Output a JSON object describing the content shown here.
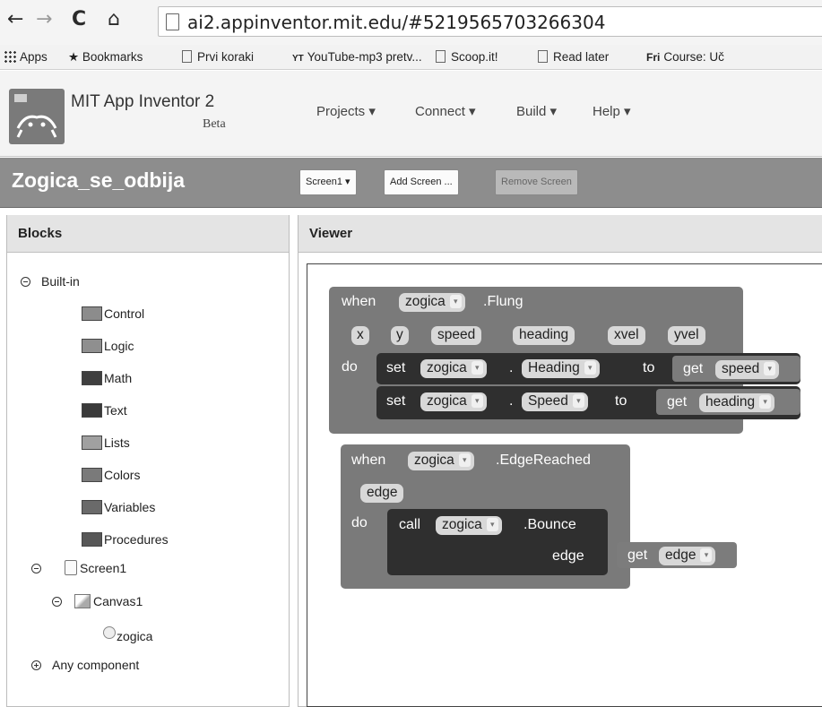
{
  "browser": {
    "url": "ai2.appinventor.mit.edu/#5219565703266304",
    "bookmarks": [
      "Apps",
      "Bookmarks",
      "Prvi koraki",
      "YouTube-mp3 pretv...",
      "Scoop.it!",
      "Read later",
      "Course: Uč"
    ],
    "bookmark_icons": [
      "apps-grid-icon",
      "star-icon",
      "page-icon",
      "youtube-mp3-icon",
      "page-icon",
      "page-icon",
      "fri-icon"
    ],
    "icons": [
      "back-arrow-icon",
      "forward-arrow-icon",
      "reload-icon",
      "home-icon",
      "page-icon"
    ]
  },
  "app": {
    "title": "MIT App Inventor 2",
    "subtitle": "Beta",
    "menu": [
      "Projects ▾",
      "Connect ▾",
      "Build ▾",
      "Help ▾"
    ]
  },
  "project": {
    "name": "Zogica_se_odbija",
    "screen_dropdown": "Screen1 ▾",
    "add_screen": "Add Screen ...",
    "remove_screen": "Remove Screen"
  },
  "blocks_panel": {
    "title": "Blocks",
    "builtin_label": "Built-in",
    "builtin": [
      "Control",
      "Logic",
      "Math",
      "Text",
      "Lists",
      "Colors",
      "Variables",
      "Procedures"
    ],
    "builtin_colors": [
      "#8c8c8c",
      "#8f8f8f",
      "#3f3f3f",
      "#3a3a3a",
      "#a0a0a0",
      "#7a7a7a",
      "#6a6a6a",
      "#575757"
    ],
    "screen": "Screen1",
    "canvas": "Canvas1",
    "sprite": "zogica",
    "any_component": "Any component"
  },
  "viewer": {
    "title": "Viewer",
    "flung": {
      "when": "when",
      "component": "zogica",
      "event": ".Flung",
      "params": [
        "x",
        "y",
        "speed",
        "heading",
        "xvel",
        "yvel"
      ],
      "do": "do",
      "rows": [
        {
          "set": "set",
          "component": "zogica",
          "dot": ".",
          "property": "Heading",
          "to": "to",
          "get": "get",
          "var": "speed"
        },
        {
          "set": "set",
          "component": "zogica",
          "dot": ".",
          "property": "Speed",
          "to": "to",
          "get": "get",
          "var": "heading"
        }
      ]
    },
    "edge": {
      "when": "when",
      "component": "zogica",
      "event": ".EdgeReached",
      "param": "edge",
      "do": "do",
      "call": "call",
      "call_component": "zogica",
      "method": ".Bounce",
      "arg_label": "edge",
      "get": "get",
      "var": "edge"
    }
  },
  "colors": {
    "event_block": "#7a7a7a",
    "inner_block": "#2f2f2f",
    "get_block": "#7c7c7c",
    "project_bar": "#8d8d8d"
  }
}
